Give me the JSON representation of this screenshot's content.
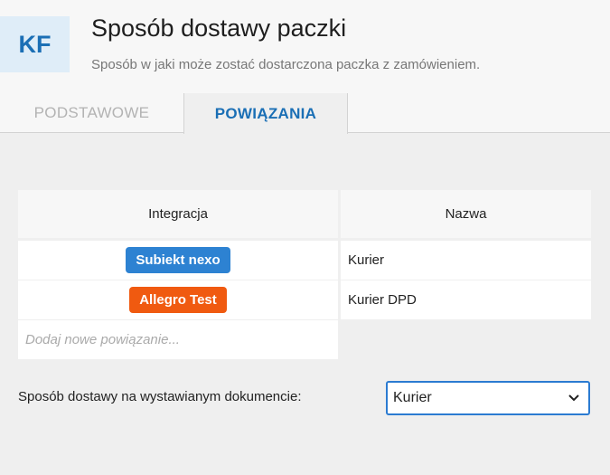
{
  "header": {
    "badge": "KF",
    "title": "Sposób dostawy paczki",
    "subtitle": "Sposób w jaki może zostać dostarczona paczka z zamówieniem."
  },
  "tabs": [
    {
      "label": "PODSTAWOWE",
      "active": false
    },
    {
      "label": "POWIĄZANIA",
      "active": true
    }
  ],
  "table": {
    "columns": [
      "Integracja",
      "Nazwa"
    ],
    "rows": [
      {
        "integration": "Subiekt nexo",
        "integration_color": "#2d82d2",
        "name": "Kurier"
      },
      {
        "integration": "Allegro Test",
        "integration_color": "#f05a10",
        "name": "Kurier DPD"
      }
    ],
    "add_placeholder": "Dodaj nowe powiązanie..."
  },
  "document_delivery": {
    "label": "Sposób dostawy na wystawianym dokumencie:",
    "selected": "Kurier"
  },
  "colors": {
    "accent": "#1b6fb5"
  }
}
